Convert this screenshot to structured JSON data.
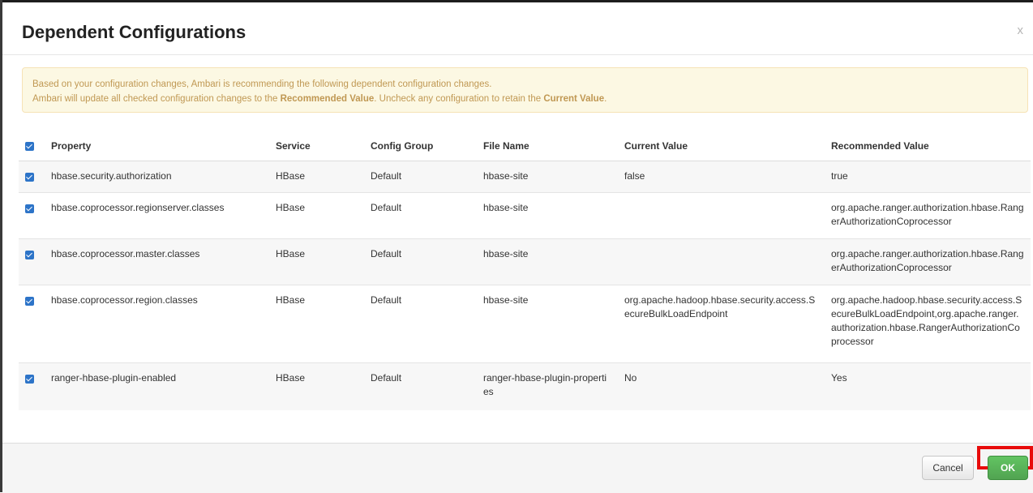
{
  "dialog": {
    "title": "Dependent Configurations",
    "close_label": "x"
  },
  "alert": {
    "line1": "Based on your configuration changes, Ambari is recommending the following dependent configuration changes.",
    "line2_pre": "Ambari will update all checked configuration changes to the ",
    "line2_bold1": "Recommended Value",
    "line2_mid": ". Uncheck any configuration to retain the ",
    "line2_bold2": "Current Value",
    "line2_end": "."
  },
  "table": {
    "headers": {
      "property": "Property",
      "service": "Service",
      "config_group": "Config Group",
      "file_name": "File Name",
      "current_value": "Current Value",
      "recommended_value": "Recommended Value"
    },
    "rows": [
      {
        "checked": true,
        "property": "hbase.security.authorization",
        "service": "HBase",
        "config_group": "Default",
        "file_name": "hbase-site",
        "current_value": "false",
        "recommended_value": "true"
      },
      {
        "checked": true,
        "property": "hbase.coprocessor.regionserver.classes",
        "service": "HBase",
        "config_group": "Default",
        "file_name": "hbase-site",
        "current_value": "",
        "recommended_value": "org.apache.ranger.authorization.hbase.RangerAuthorizationCoprocessor"
      },
      {
        "checked": true,
        "property": "hbase.coprocessor.master.classes",
        "service": "HBase",
        "config_group": "Default",
        "file_name": "hbase-site",
        "current_value": "",
        "recommended_value": "org.apache.ranger.authorization.hbase.RangerAuthorizationCoprocessor"
      },
      {
        "checked": true,
        "property": "hbase.coprocessor.region.classes",
        "service": "HBase",
        "config_group": "Default",
        "file_name": "hbase-site",
        "current_value": "org.apache.hadoop.hbase.security.access.SecureBulkLoadEndpoint",
        "recommended_value": "org.apache.hadoop.hbase.security.access.SecureBulkLoadEndpoint,org.apache.ranger.authorization.hbase.RangerAuthorizationCoprocessor"
      },
      {
        "checked": true,
        "property": "ranger-hbase-plugin-enabled",
        "service": "HBase",
        "config_group": "Default",
        "file_name": "ranger-hbase-plugin-properties",
        "current_value": "No",
        "recommended_value": "Yes"
      }
    ]
  },
  "footer": {
    "cancel_label": "Cancel",
    "ok_label": "OK"
  },
  "colors": {
    "alert_bg": "#fcf8e3",
    "alert_text": "#c09853",
    "checkbox": "#2d74c8",
    "ok_button": "#5bb75b",
    "highlight_box": "#e80b0b"
  }
}
